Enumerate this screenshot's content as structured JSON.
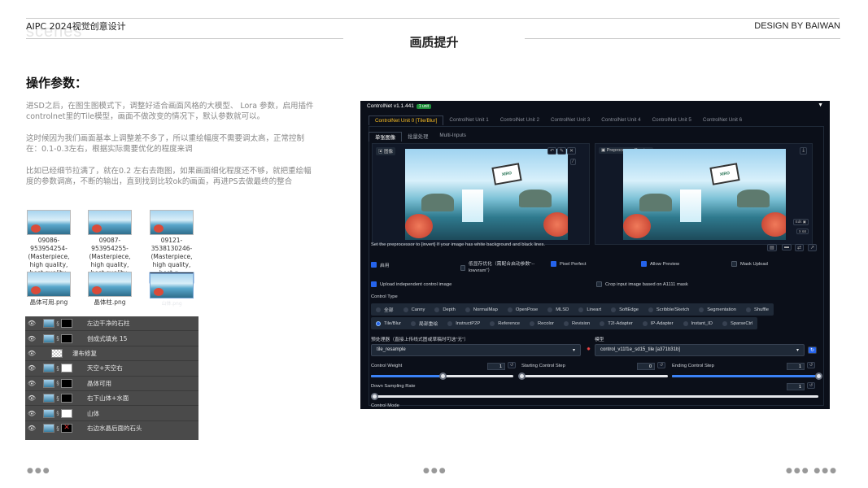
{
  "header": {
    "left": "AIPC 2024视觉创意设计",
    "ghost": "scenes",
    "right": "DESIGN BY BAIWAN",
    "center_title": "画质提升"
  },
  "left": {
    "section_title": "操作参数：",
    "p1": "进SD之后，在图生图模式下，调整好适合画面风格的大模型、 Lora 参数，启用插件controlnet里的Tile模型，画面不做改变的情况下，默认参数就可以。",
    "p2": "这时候因为我们画面基本上调整差不多了，所以重绘幅度不需要调太高，正常控制在：0.1-0.3左右，根据实际需要优化的程度来调",
    "p3": "比如已经细节拉满了，就在0.2 左右去跑图，如果画面细化程度还不够，就把重绘幅度的参数调高，不断的输出，直到找到比较ok的画面，再进PS去做最终的整合",
    "thumbs": [
      {
        "label": "09086-953954254-(Masterpiece, high quality, best quality, o..."
      },
      {
        "label": "09087-953954255-(Masterpiece, high quality, best quality, o..."
      },
      {
        "label": "09121-3538130246-(Masterpiece, high quality, best q..."
      },
      {
        "label": "晶体可用.png"
      },
      {
        "label": "晶体柱.png"
      },
      {
        "label": "山体.png"
      }
    ],
    "layers": [
      {
        "name": "左边干净的石柱"
      },
      {
        "name": "创成式填充 15"
      },
      {
        "name": "瀑布修复"
      },
      {
        "name": "天空+天空右"
      },
      {
        "name": "晶体可用"
      },
      {
        "name": "右下山体+水面"
      },
      {
        "name": "山体"
      },
      {
        "name": "右边水晶后面的石头"
      }
    ]
  },
  "controlnet": {
    "title": "ControlNet v1.1.441",
    "badge": "1 unit",
    "units": [
      "ControlNet Unit 0 [Tile/Blur]",
      "ControlNet Unit 1",
      "ControlNet Unit 2",
      "ControlNet Unit 3",
      "ControlNet Unit 4",
      "ControlNet Unit 5",
      "ControlNet Unit 6"
    ],
    "subtabs": [
      "单张图像",
      "批量处理",
      "Multi-Inputs"
    ],
    "image_label": "图像",
    "preview_label": "Preprocessor Preview",
    "note": "Set the preprocessor to [invert] If your image has white background and black lines.",
    "checks": {
      "enable": "启用",
      "lowvram": "低显存优化（需配合启动参数\"--lowvram\"）",
      "pixel_perfect": "Pixel Perfect",
      "allow_preview": "Allow Preview",
      "mask_upload": "Mask Upload",
      "upload_independent": "Upload independent control image",
      "crop": "Crop input image based on A1111 mask"
    },
    "control_type_label": "Control Type",
    "types_row1": [
      "全部",
      "Canny",
      "Depth",
      "NormalMap",
      "OpenPose",
      "MLSD",
      "Lineart",
      "SoftEdge",
      "Scribble/Sketch",
      "Segmentation",
      "Shuffle"
    ],
    "types_row2": [
      "Tile/Blur",
      "局部重绘",
      "InstructP2P",
      "Reference",
      "Recolor",
      "Revision",
      "T2I-Adapter",
      "IP-Adapter",
      "Instant_ID",
      "SparseCtrl"
    ],
    "preprocessor_label": "预处理器（直接上传线式图或草稿时可选\"无\"）",
    "preprocessor_value": "tile_resample",
    "model_label": "模型",
    "model_value": "control_v11f1e_sd15_tile [a371b31b]",
    "weight_label": "Control Weight",
    "weight_value": "1",
    "start_label": "Starting Control Step",
    "start_value": "0",
    "end_label": "Ending Control Step",
    "end_value": "1",
    "downsample_label": "Down Sampling Rate",
    "downsample_value": "1",
    "mode_label": "Control Mode",
    "edit_label": "Edit",
    "x68_label": "X 68",
    "colors": {
      "accent": "#fbbf24",
      "blue": "#2563eb",
      "bg": "#0b0f19"
    }
  }
}
